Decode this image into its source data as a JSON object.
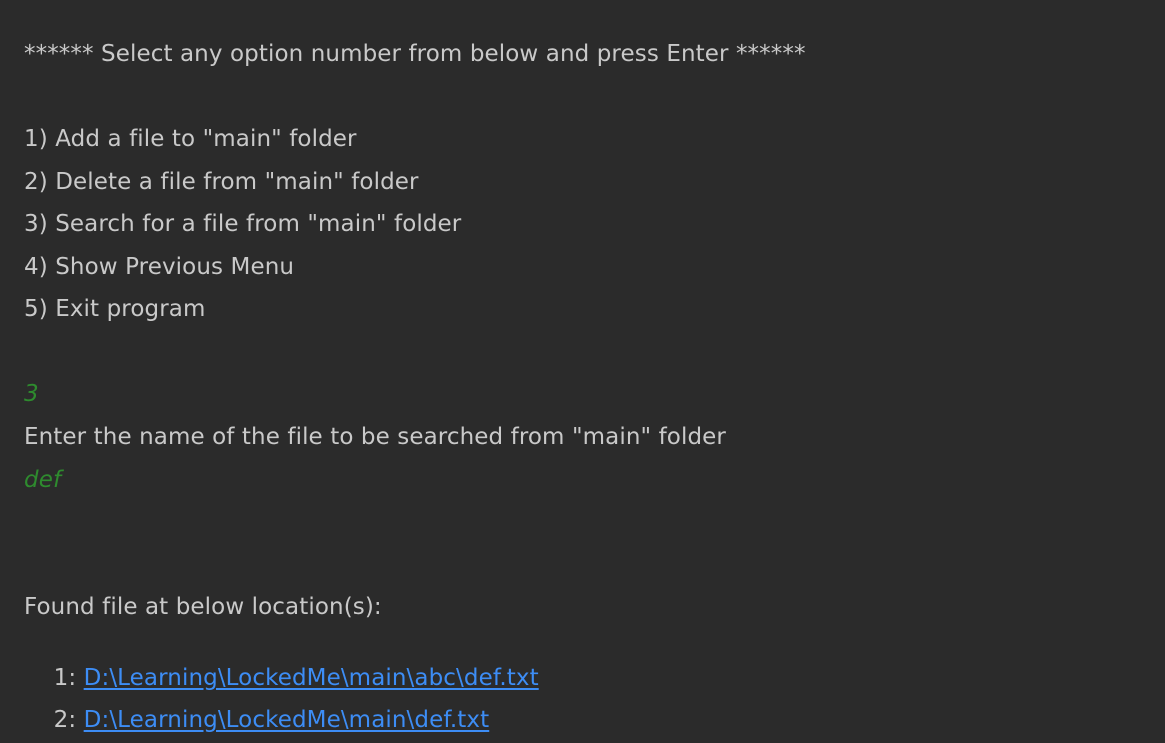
{
  "console": {
    "header": "****** Select any option number from below and press Enter ******",
    "options": [
      "1) Add a file to \"main\" folder",
      "2) Delete a file from \"main\" folder",
      "3) Search for a file from \"main\" folder",
      "4) Show Previous Menu",
      "5) Exit program"
    ],
    "user_choice": "3",
    "prompt": "Enter the name of the file to be searched from \"main\" folder",
    "user_filename": "def",
    "result_heading": "Found file at below location(s):",
    "results": [
      {
        "prefix": "1: ",
        "path": "D:\\Learning\\LockedMe\\main\\abc\\def.txt"
      },
      {
        "prefix": "2: ",
        "path": "D:\\Learning\\LockedMe\\main\\def.txt"
      }
    ]
  },
  "colors": {
    "background": "#2b2b2b",
    "text": "#c9c9c9",
    "user_input": "#2e8b2e",
    "link": "#3d8df5"
  }
}
